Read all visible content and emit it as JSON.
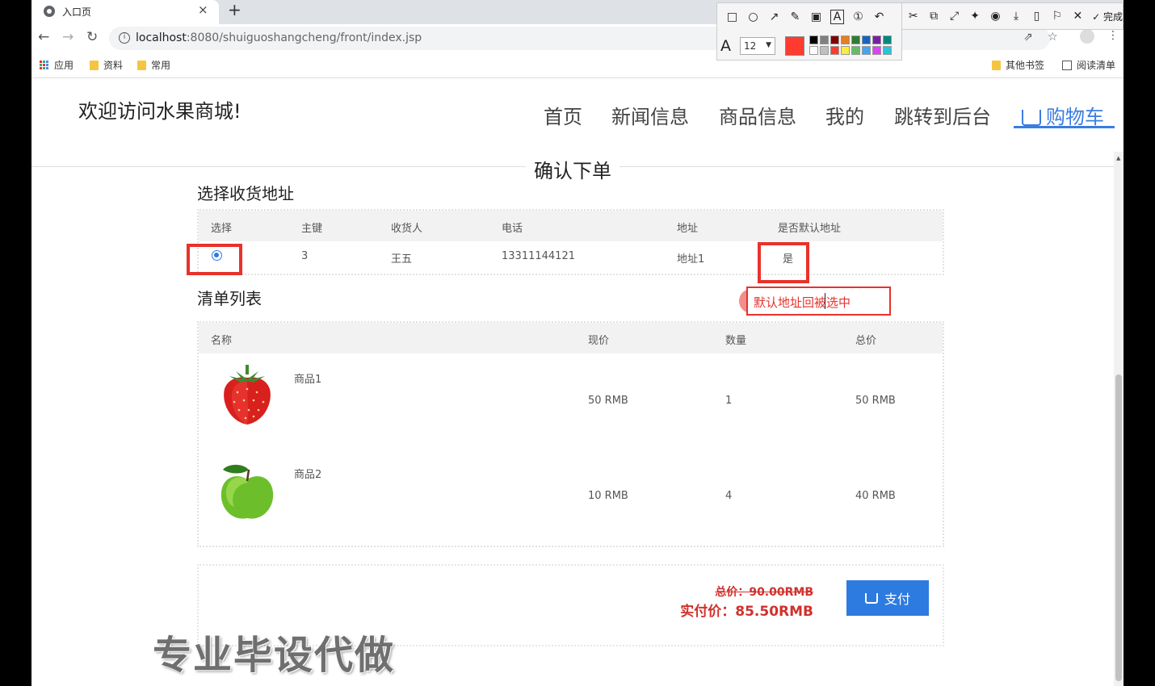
{
  "browser": {
    "tab_title": "入口页",
    "tab_close": "×",
    "new_tab": "+",
    "url_host": "localhost",
    "url_path": ":8080/shuiguoshangcheng/front/index.jsp",
    "bookmarks": [
      "应用",
      "资料",
      "常用"
    ],
    "bookmarks_right": [
      "其他书签",
      "阅读清单"
    ]
  },
  "annotation_toolbar": {
    "done_label": "完成",
    "font_size": "12",
    "current_color": "#ff3b30",
    "palette": [
      "#000000",
      "#808080",
      "#800000",
      "#e67e22",
      "#2e7d32",
      "#1565c0",
      "#7b1fa2",
      "#00897b",
      "#ffffff",
      "#c0c0c0",
      "#ff3b30",
      "#ffeb3b",
      "#66bb6a",
      "#42a5f5",
      "#e040fb",
      "#26c6da"
    ]
  },
  "header": {
    "site_title": "欢迎访问水果商城!",
    "nav": [
      "首页",
      "新闻信息",
      "商品信息",
      "我的",
      "跳转到后台",
      "购物车"
    ],
    "active_color": "#3b7de0"
  },
  "page": {
    "confirm_title": "确认下单"
  },
  "address_section": {
    "title": "选择收货地址",
    "columns": [
      "选择",
      "主键",
      "收货人",
      "电话",
      "地址",
      "是否默认地址"
    ],
    "rows": [
      {
        "selected": true,
        "id": "3",
        "receiver": "王五",
        "phone": "13311144121",
        "address": "地址1",
        "is_default": "是"
      }
    ]
  },
  "annotation_note": "默认地址回被选中",
  "order_section": {
    "title": "清单列表",
    "columns": [
      "名称",
      "现价",
      "数量",
      "总价"
    ],
    "items": [
      {
        "name": "商品1",
        "image": "strawberry",
        "price": "50 RMB",
        "qty": "1",
        "total": "50 RMB"
      },
      {
        "name": "商品2",
        "image": "green-apple",
        "price": "10 RMB",
        "qty": "4",
        "total": "40 RMB"
      }
    ]
  },
  "summary": {
    "original_total": "总价：90.00RMB",
    "pay_total": "实付价：85.50RMB",
    "pay_button": "支付",
    "accent_color": "#d0312d"
  },
  "watermark": "专业毕设代做"
}
